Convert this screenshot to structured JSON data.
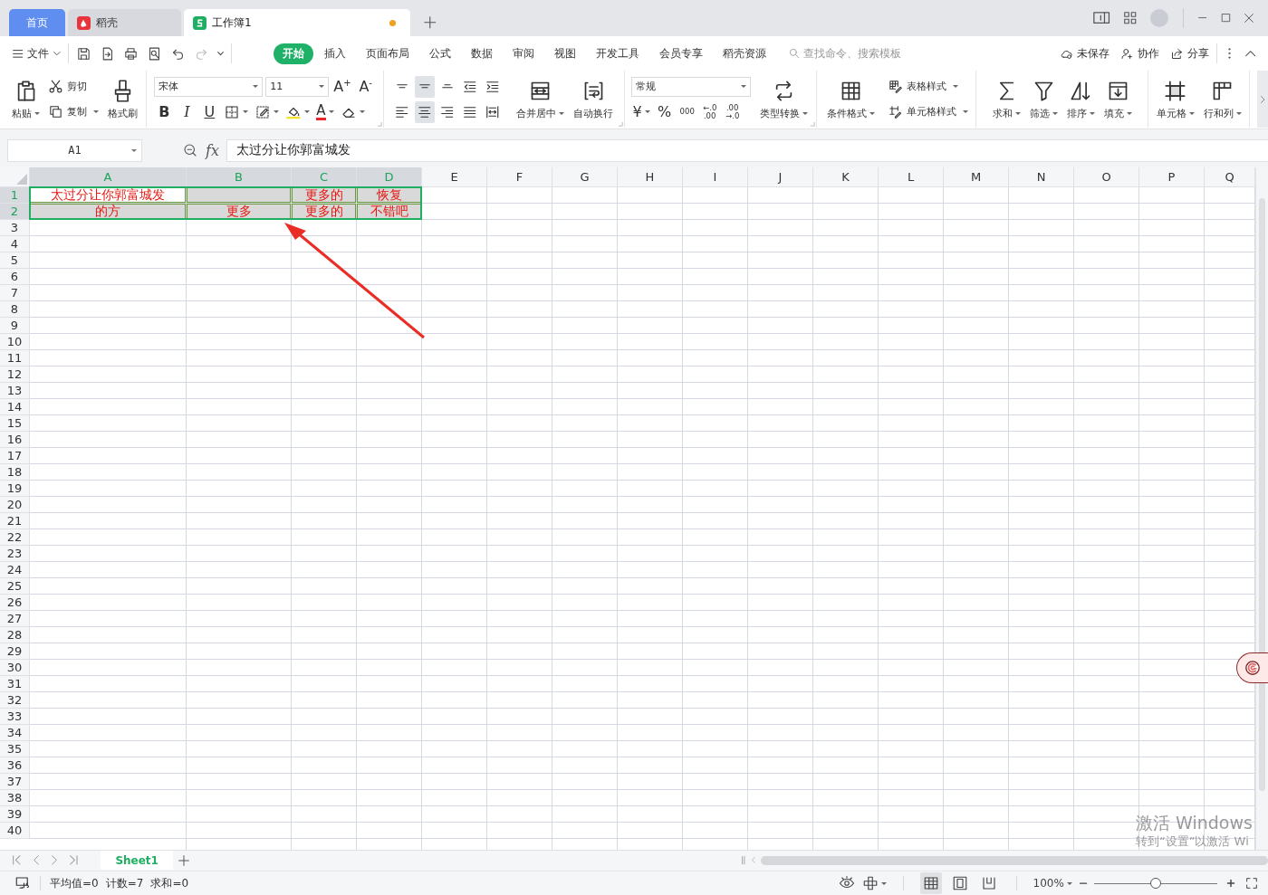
{
  "title_bar": {
    "tabs": [
      {
        "kind": "home",
        "label": "首页",
        "selected": false,
        "unsaved": false
      },
      {
        "kind": "docer",
        "label": "稻壳",
        "selected": false,
        "unsaved": false
      },
      {
        "kind": "workbook",
        "label": "工作簿1",
        "selected": true,
        "unsaved": true
      }
    ]
  },
  "menu_bar": {
    "file_label": "文件",
    "tabs": [
      {
        "label": "开始",
        "selected": true
      },
      {
        "label": "插入",
        "selected": false
      },
      {
        "label": "页面布局",
        "selected": false
      },
      {
        "label": "公式",
        "selected": false
      },
      {
        "label": "数据",
        "selected": false
      },
      {
        "label": "审阅",
        "selected": false
      },
      {
        "label": "视图",
        "selected": false
      },
      {
        "label": "开发工具",
        "selected": false
      },
      {
        "label": "会员专享",
        "selected": false
      },
      {
        "label": "稻壳资源",
        "selected": false
      }
    ],
    "search": {
      "placeholder": "查找命令、搜索模板"
    },
    "actions": [
      {
        "kind": "cloud",
        "label": "未保存"
      },
      {
        "kind": "collab",
        "label": "协作"
      },
      {
        "kind": "share",
        "label": "分享"
      }
    ]
  },
  "ribbon": {
    "groups": [
      {
        "columns": [
          {
            "kind": "large",
            "items": [
              {
                "kind": "paste",
                "label": "粘贴",
                "dropdown": true
              }
            ]
          },
          {
            "kind": "stacked",
            "items": [
              {
                "kind": "cut",
                "label": "剪切",
                "dropdown": false
              },
              {
                "kind": "copy",
                "label": "复制",
                "dropdown": true
              }
            ]
          },
          {
            "kind": "large",
            "items": [
              {
                "kind": "format_painter",
                "label": "格式刷",
                "dropdown": false
              }
            ]
          }
        ]
      },
      {
        "launcher": true,
        "columns": [
          {
            "kind": "lines",
            "lines": [
              [
                {
                  "kind": "font_select",
                  "value": "宋体",
                  "dropdown": true
                },
                {
                  "kind": "size_select",
                  "value": "11",
                  "dropdown": true
                },
                {
                  "kind": "grow",
                  "label": "A",
                  "sup": "+",
                  "dropdown": false
                },
                {
                  "kind": "shrink",
                  "label": "A",
                  "sup": "-",
                  "dropdown": false
                }
              ],
              [
                {
                  "kind": "bold",
                  "label": "B",
                  "dropdown": false
                },
                {
                  "kind": "italic",
                  "label": "I",
                  "dropdown": false
                },
                {
                  "kind": "underline",
                  "label": "U",
                  "dropdown": false
                },
                {
                  "kind": "borders",
                  "dropdown": true
                },
                {
                  "kind": "cell_fill_style",
                  "dropdown": true
                },
                {
                  "kind": "fill_color",
                  "dropdown": true
                },
                {
                  "kind": "font_color",
                  "label": "A",
                  "dropdown": true
                },
                {
                  "kind": "eraser",
                  "dropdown": true
                }
              ]
            ]
          }
        ]
      },
      {
        "launcher": true,
        "columns": [
          {
            "kind": "lines",
            "lines": [
              [
                {
                  "kind": "align_top",
                  "on": false,
                  "dropdown": false
                },
                {
                  "kind": "align_middle",
                  "on": true,
                  "dropdown": false
                },
                {
                  "kind": "align_bottom",
                  "on": false,
                  "dropdown": false
                },
                {
                  "kind": "indent_decrease",
                  "on": false,
                  "dropdown": false
                },
                {
                  "kind": "indent_increase",
                  "on": false,
                  "dropdown": false
                }
              ],
              [
                {
                  "kind": "align_left",
                  "on": false,
                  "dropdown": false
                },
                {
                  "kind": "align_center",
                  "on": true,
                  "dropdown": false
                },
                {
                  "kind": "align_right",
                  "on": false,
                  "dropdown": false
                },
                {
                  "kind": "justify",
                  "on": false,
                  "dropdown": false
                },
                {
                  "kind": "distributed",
                  "on": false,
                  "dropdown": false
                }
              ]
            ]
          },
          {
            "kind": "large",
            "items": [
              {
                "kind": "merge",
                "label": "合并居中",
                "dropdown": true
              },
              {
                "kind": "wrap",
                "label": "自动换行",
                "dropdown": false
              }
            ]
          }
        ]
      },
      {
        "launcher": true,
        "columns": [
          {
            "kind": "lines",
            "lines": [
              [
                {
                  "kind": "number_select",
                  "value": "常规",
                  "dropdown": true
                }
              ],
              [
                {
                  "kind": "currency",
                  "label": "¥",
                  "dropdown": true
                },
                {
                  "kind": "percent",
                  "label": "%",
                  "dropdown": false
                },
                {
                  "kind": "thousands",
                  "label": "000",
                  "dropdown": false
                },
                {
                  "kind": "decimal_increase",
                  "label": "←.0 .00",
                  "dropdown": false
                },
                {
                  "kind": "decimal_decrease",
                  "label": ".00 →.0",
                  "dropdown": false
                }
              ]
            ]
          },
          {
            "kind": "large",
            "items": [
              {
                "kind": "type_convert",
                "label": "类型转换",
                "dropdown": true
              }
            ]
          }
        ]
      },
      {
        "columns": [
          {
            "kind": "large",
            "items": [
              {
                "kind": "conditional_format",
                "label": "条件格式",
                "dropdown": true
              }
            ]
          },
          {
            "kind": "stacked",
            "items": [
              {
                "kind": "table_style",
                "label": "表格样式",
                "dropdown": true
              },
              {
                "kind": "cell_style",
                "label": "单元格样式",
                "dropdown": true
              }
            ]
          }
        ]
      },
      {
        "columns": [
          {
            "kind": "large",
            "items": [
              {
                "kind": "sum",
                "label": "求和",
                "dropdown": true
              },
              {
                "kind": "filter",
                "label": "筛选",
                "dropdown": true
              },
              {
                "kind": "sort",
                "label": "排序",
                "dropdown": true
              },
              {
                "kind": "fill",
                "label": "填充",
                "dropdown": true
              }
            ]
          }
        ]
      },
      {
        "columns": [
          {
            "kind": "large",
            "items": [
              {
                "kind": "cell",
                "label": "单元格",
                "dropdown": true
              },
              {
                "kind": "row_col",
                "label": "行和列",
                "dropdown": true
              }
            ]
          }
        ]
      }
    ]
  },
  "formula_bar": {
    "cell_ref": "A1",
    "fx_label": "fx",
    "formula": "太过分让你郭富城发"
  },
  "grid": {
    "columns": [
      {
        "label": "A",
        "selected": true
      },
      {
        "label": "B",
        "selected": true
      },
      {
        "label": "C",
        "selected": true
      },
      {
        "label": "D",
        "selected": true
      },
      {
        "label": "E",
        "selected": false
      },
      {
        "label": "F",
        "selected": false
      },
      {
        "label": "G",
        "selected": false
      },
      {
        "label": "H",
        "selected": false
      },
      {
        "label": "I",
        "selected": false
      },
      {
        "label": "J",
        "selected": false
      },
      {
        "label": "K",
        "selected": false
      },
      {
        "label": "L",
        "selected": false
      },
      {
        "label": "M",
        "selected": false
      },
      {
        "label": "N",
        "selected": false
      },
      {
        "label": "O",
        "selected": false
      },
      {
        "label": "P",
        "selected": false
      },
      {
        "label": "Q",
        "selected": false
      }
    ],
    "rows": [
      {
        "label": "1",
        "selected": true,
        "cells": [
          {
            "text": "太过分让你郭富城发",
            "selected": true,
            "active": true
          },
          {
            "selected": true,
            "active": false
          },
          {
            "text": "更多的",
            "selected": true,
            "active": false
          },
          {
            "text": "恢复",
            "selected": true,
            "active": false
          }
        ]
      },
      {
        "label": "2",
        "selected": true,
        "cells": [
          {
            "text": "的方",
            "selected": true,
            "active": false
          },
          {
            "text": "更多",
            "selected": true,
            "active": false
          },
          {
            "text": "更多的",
            "selected": true,
            "active": false
          },
          {
            "text": "不错吧",
            "selected": true,
            "active": false
          }
        ]
      },
      {
        "label": "3",
        "selected": false
      },
      {
        "label": "4",
        "selected": false
      },
      {
        "label": "5",
        "selected": false
      },
      {
        "label": "6",
        "selected": false
      },
      {
        "label": "7",
        "selected": false
      },
      {
        "label": "8",
        "selected": false
      },
      {
        "label": "9",
        "selected": false
      },
      {
        "label": "10",
        "selected": false
      },
      {
        "label": "11",
        "selected": false
      },
      {
        "label": "12",
        "selected": false
      },
      {
        "label": "13",
        "selected": false
      },
      {
        "label": "14",
        "selected": false
      },
      {
        "label": "15",
        "selected": false
      },
      {
        "label": "16",
        "selected": false
      },
      {
        "label": "17",
        "selected": false
      },
      {
        "label": "18",
        "selected": false
      },
      {
        "label": "19",
        "selected": false
      },
      {
        "label": "20",
        "selected": false
      },
      {
        "label": "21",
        "selected": false
      },
      {
        "label": "22",
        "selected": false
      },
      {
        "label": "23",
        "selected": false
      },
      {
        "label": "24",
        "selected": false
      },
      {
        "label": "25",
        "selected": false
      },
      {
        "label": "26",
        "selected": false
      },
      {
        "label": "27",
        "selected": false
      },
      {
        "label": "28",
        "selected": false
      },
      {
        "label": "29",
        "selected": false
      },
      {
        "label": "30",
        "selected": false
      },
      {
        "label": "31",
        "selected": false
      },
      {
        "label": "32",
        "selected": false
      },
      {
        "label": "33",
        "selected": false
      },
      {
        "label": "34",
        "selected": false
      },
      {
        "label": "35",
        "selected": false
      },
      {
        "label": "36",
        "selected": false
      },
      {
        "label": "37",
        "selected": false
      },
      {
        "label": "38",
        "selected": false
      },
      {
        "label": "39",
        "selected": false
      },
      {
        "label": "40",
        "selected": false
      }
    ]
  },
  "sheet_tabs": [
    {
      "label": "Sheet1",
      "selected": true
    }
  ],
  "status_bar": {
    "stats": [
      "平均值=0",
      "计数=7",
      "求和=0"
    ],
    "views": [
      {
        "kind": "normal",
        "selected": true
      },
      {
        "kind": "page_break",
        "selected": false
      },
      {
        "kind": "page_layout",
        "selected": false
      }
    ],
    "zoom": {
      "label": "100%",
      "level": 0.5
    }
  },
  "os_notice": {
    "title": "激活 Windows",
    "subtitle": "转到“设置”以激活 Wi"
  }
}
